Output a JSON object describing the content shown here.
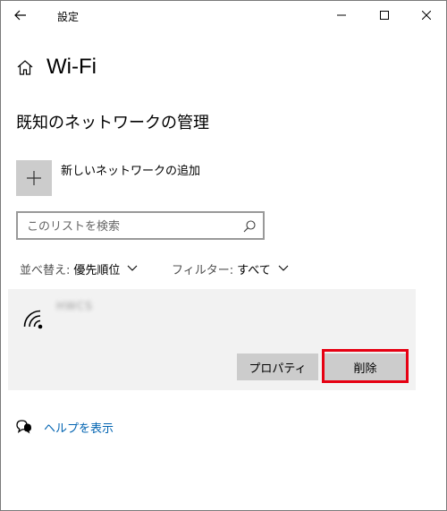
{
  "window": {
    "title": "設定",
    "controls": {
      "back_icon": "back-arrow-icon",
      "minimize_icon": "minimize-icon",
      "maximize_icon": "maximize-icon",
      "close_icon": "close-icon"
    }
  },
  "header": {
    "home_icon": "home-icon",
    "title": "Wi-Fi"
  },
  "section": {
    "title": "既知のネットワークの管理"
  },
  "add_network": {
    "icon": "plus-icon",
    "label": "新しいネットワークの追加"
  },
  "search": {
    "placeholder": "このリストを検索",
    "value": "",
    "icon": "search-icon"
  },
  "sort": {
    "prefix": "並べ替え:",
    "value": "優先順位"
  },
  "filter": {
    "prefix": "フィルター:",
    "value": "すべて"
  },
  "networks": [
    {
      "icon": "wifi-signal-icon",
      "ssid": "HWCS",
      "buttons": {
        "properties": "プロパティ",
        "delete": "削除"
      }
    }
  ],
  "help": {
    "icon": "help-chat-icon",
    "label": "ヘルプを表示"
  },
  "colors": {
    "accent_link": "#0063b1",
    "highlight": "#e60012",
    "button_bg": "#cccccc",
    "item_bg": "#f2f2f2"
  }
}
